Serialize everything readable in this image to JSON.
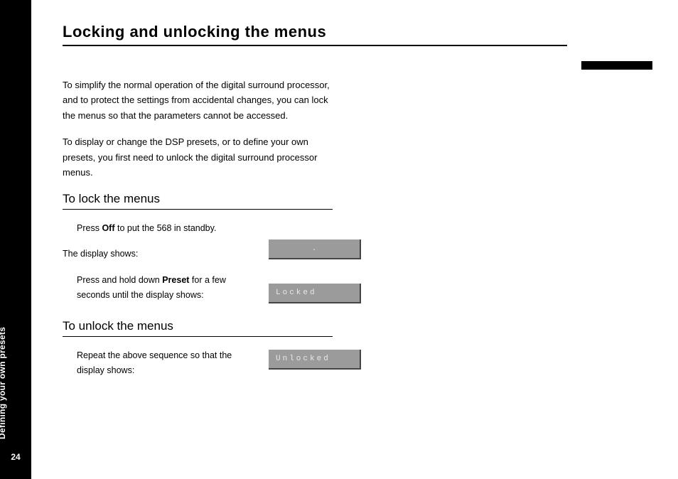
{
  "tab": {
    "label": "Defining your own presets",
    "page": "24"
  },
  "title": "Locking and unlocking the menus",
  "intro": {
    "p1": "To simplify the normal operation of the digital surround processor, and to protect the settings from accidental changes, you can lock the menus so that the parameters cannot be accessed.",
    "p2": "To display or change the DSP presets, or to define your own presets, you first need to unlock the digital surround processor menus."
  },
  "lock": {
    "heading": "To lock the menus",
    "press_pre": "Press ",
    "press_bold": "Off",
    "press_post": " to put the 568 in standby.",
    "shows_label": "The display shows:",
    "display_dot": ".",
    "hold_pre": "Press and hold down ",
    "hold_bold": "Preset",
    "hold_post": " for a few seconds until the display shows:",
    "display_locked": "Locked"
  },
  "unlock": {
    "heading": "To unlock the menus",
    "repeat": "Repeat the above sequence so that the display shows:",
    "display_unlocked": "Unlocked"
  }
}
